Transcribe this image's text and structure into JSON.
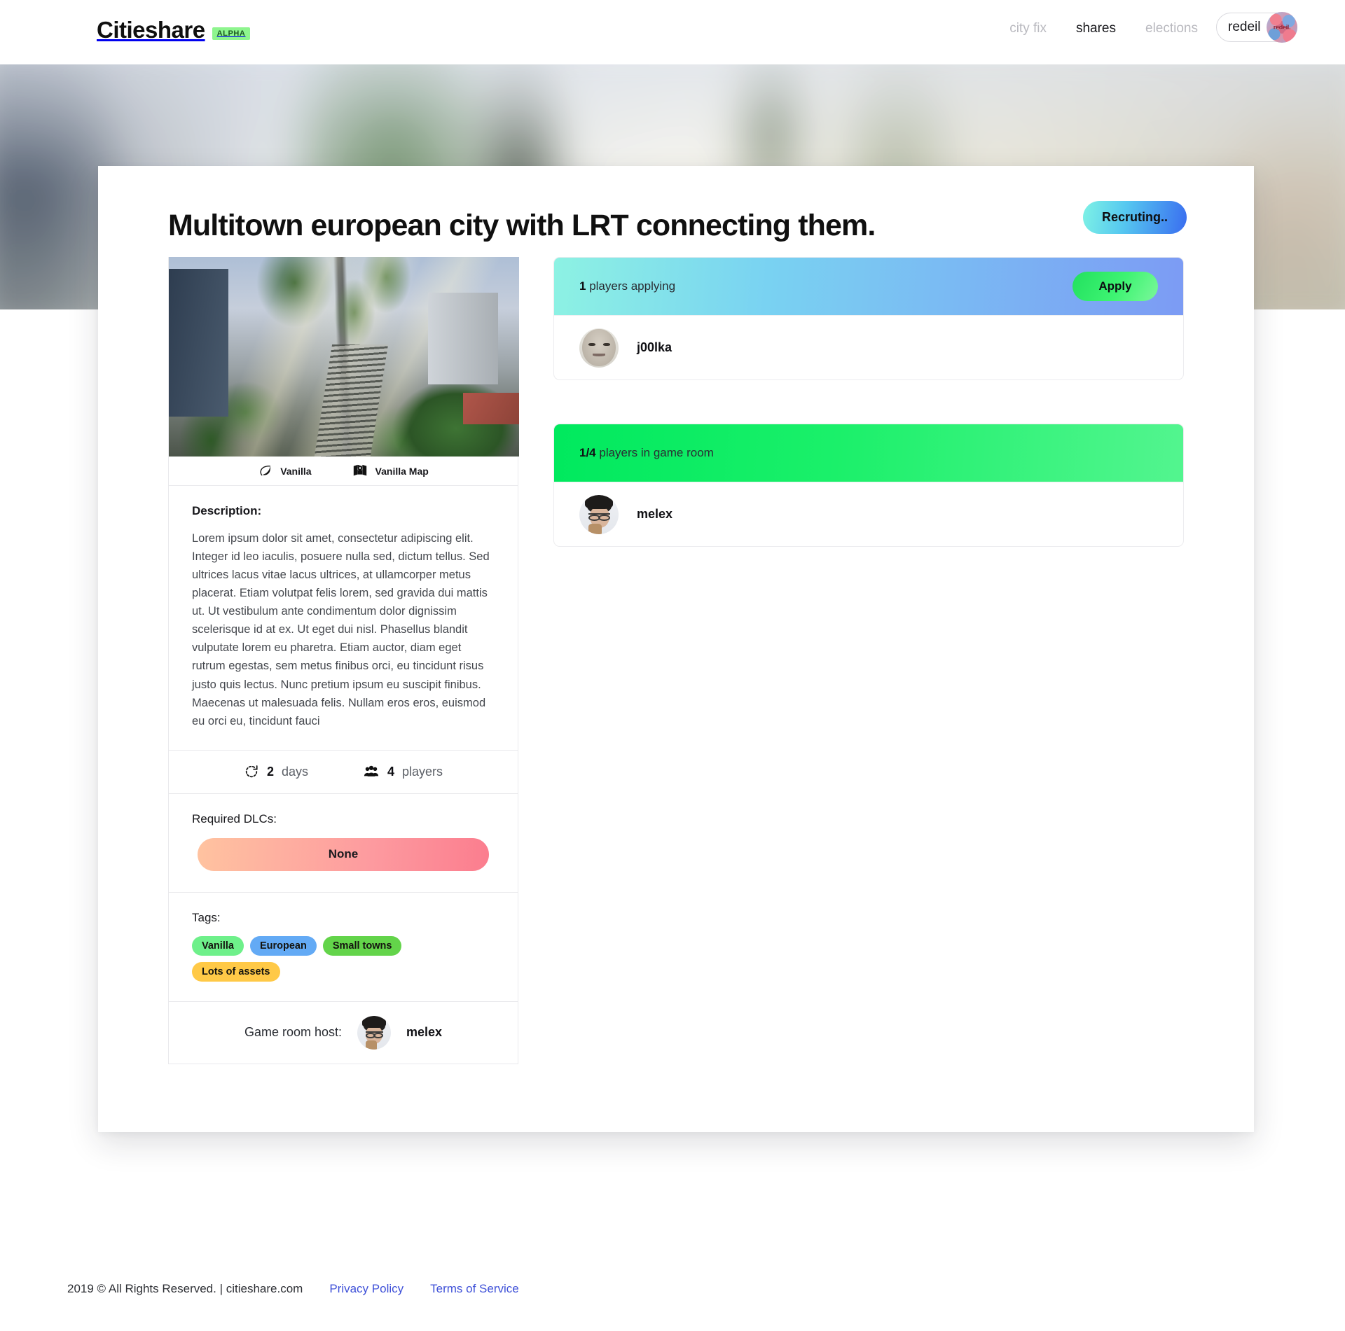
{
  "navbar": {
    "brand": "Citieshare",
    "brand_badge": "ALPHA",
    "links": [
      {
        "label": "city fix",
        "active": false
      },
      {
        "label": "shares",
        "active": true
      },
      {
        "label": "elections",
        "active": false
      }
    ],
    "user": {
      "name": "redeil",
      "avatar_tag": "redeil."
    }
  },
  "listing": {
    "title": "Multitown european city with LRT connecting them.",
    "status": "Recruting..",
    "status_gradient": [
      "#7ef2e5",
      "#3a6df0"
    ],
    "screenshot_alt": "city-screenshot",
    "meta": [
      {
        "icon": "leaf-icon",
        "label": "Vanilla"
      },
      {
        "icon": "map-icon",
        "label": "Vanilla Map"
      }
    ],
    "description_title": "Description:",
    "description": "Lorem ipsum dolor sit amet, consectetur adipiscing elit. Integer id leo iaculis, posuere nulla sed, dictum tellus. Sed ultrices lacus vitae lacus ultrices, at ullamcorper metus placerat. Etiam volutpat felis lorem, sed gravida dui mattis ut. Ut vestibulum ante condimentum dolor dignissim scelerisque id at ex. Ut eget dui nisl. Phasellus blandit vulputate lorem eu pharetra. Etiam auctor, diam eget rutrum egestas, sem metus finibus orci, eu tincidunt risus justo quis lectus. Nunc pretium ipsum eu suscipit finibus. Maecenas ut malesuada felis. Nullam eros eros, euismod eu orci eu, tincidunt fauci",
    "stats": {
      "duration_value": "2",
      "duration_unit": "days",
      "players_value": "4",
      "players_unit": "players"
    },
    "dlc_title": "Required DLCs:",
    "dlc_value": "None",
    "tags_title": "Tags:",
    "tags": [
      {
        "label": "Vanilla",
        "color": "#6ef08a"
      },
      {
        "label": "European",
        "color": "#63aaf5"
      },
      {
        "label": "Small towns",
        "color": "#63d44a"
      },
      {
        "label": "Lots of assets",
        "color": "#ffc council"
      }
    ],
    "host_label": "Game room host:",
    "host_name": "melex"
  },
  "applying": {
    "count_value": "1",
    "count_text": "players applying",
    "apply_label": "Apply",
    "members": [
      {
        "name": "j00lka",
        "avatar": "face-j00lka"
      }
    ]
  },
  "game_room": {
    "count_value": "1/4",
    "count_text": "players in game room",
    "members": [
      {
        "name": "melex",
        "avatar": "face-melex"
      }
    ]
  },
  "footer": {
    "copyright": "2019 © All Rights Reserved. | citieshare.com",
    "links": [
      {
        "label": "Privacy Policy"
      },
      {
        "label": "Terms of Service"
      }
    ]
  }
}
